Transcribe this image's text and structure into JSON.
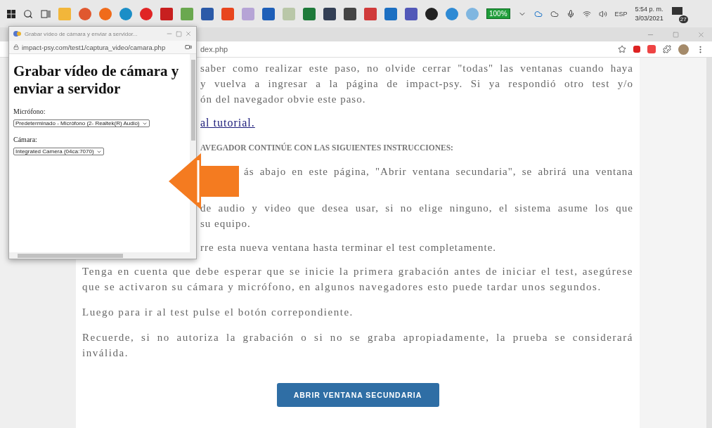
{
  "taskbar": {
    "battery_badge": "100%",
    "language": "ESP",
    "time": "5:54 p. m.",
    "date": "3/03/2021",
    "notifications": "27"
  },
  "browser": {
    "address_fragment": "dex.php"
  },
  "popup": {
    "title": "Grabar vídeo de cámara y enviar a servidor...",
    "url": "impact-psy.com/test1/captura_video/camara.php",
    "heading": "Grabar vídeo de cámara y enviar a servidor",
    "fields": [
      {
        "label": "Micrófono:",
        "value": "Predeterminado - Micrófono (2- Realtek(R) Audio)"
      },
      {
        "label": "Cámara:",
        "value": "Integrated Camera (04ca:7070)"
      }
    ]
  },
  "page": {
    "blocks": [
      {
        "kind": "fragment",
        "lines": [
          "saber como realizar este paso, no olvide cerrar \"todas\" las ventanas cuando haya",
          "y vuelva a ingresar a la página de impact-psy. Si ya respondió otro test y/o",
          "ón del navegador obvie este paso."
        ]
      },
      {
        "kind": "link",
        "text": "al tutorial."
      },
      {
        "kind": "heading",
        "text": "AVEGADOR CONTINÚE CON LAS SIGUIENTES INSTRUCCIONES:"
      },
      {
        "kind": "arrow_fragment",
        "lines": [
          "ás abajo en este página, \"Abrir ventana secundaria\", se abrirá una ventana"
        ]
      },
      {
        "kind": "fragment",
        "lines": [
          "de audio y video que desea usar, si no elige ninguno, el sistema asume los que",
          "su equipo."
        ]
      },
      {
        "kind": "fragment",
        "lines": [
          "rre esta nueva ventana hasta terminar el test completamente."
        ]
      },
      {
        "kind": "paragraph",
        "text": "Tenga en cuenta que debe esperar que se inicie la primera grabación antes de iniciar el test, asegúrese que se activaron su cámara y micrófono, en algunos navegadores esto puede tardar unos segundos."
      },
      {
        "kind": "paragraph",
        "text": "Luego para ir al test pulse el botón correpondiente."
      },
      {
        "kind": "paragraph",
        "text": "Recuerde, si no autoriza la grabación o si no se graba apropiadamente, la prueba se considerará inválida."
      }
    ],
    "button": "ABRIR VENTANA SECUNDARIA"
  }
}
